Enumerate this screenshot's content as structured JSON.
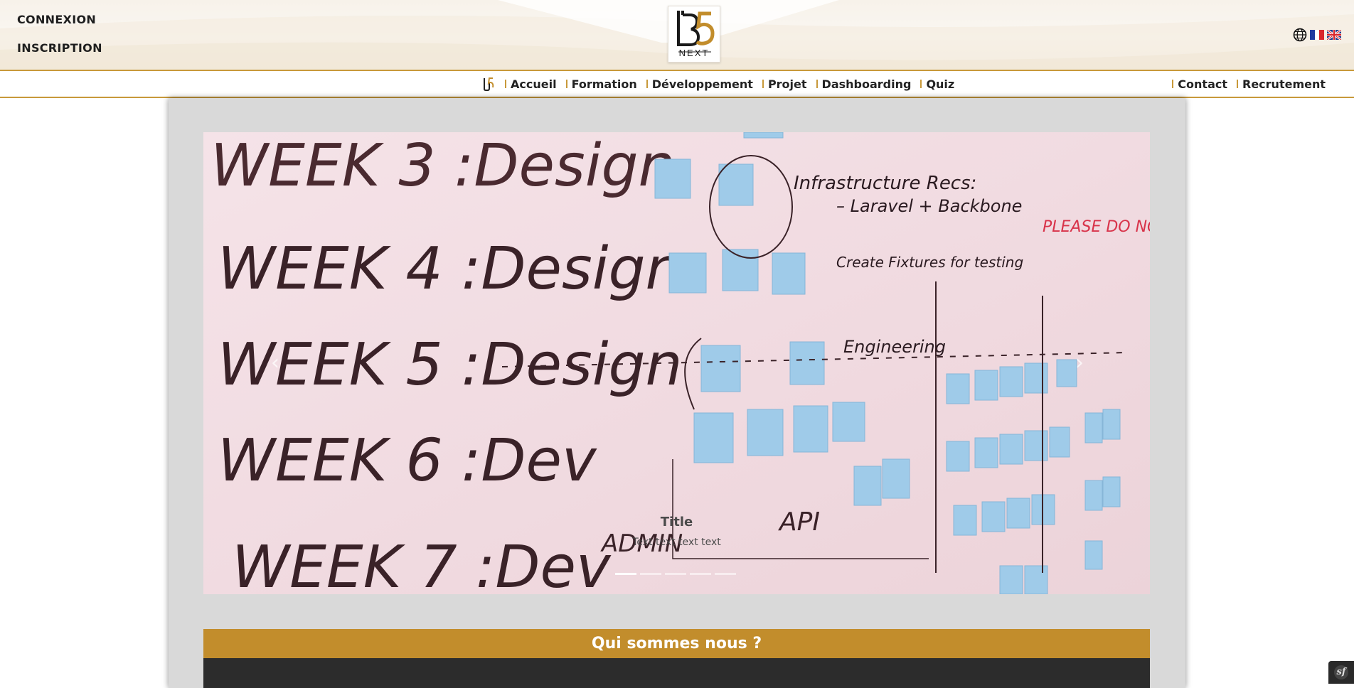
{
  "header": {
    "auth_links": [
      {
        "label": "CONNEXION"
      },
      {
        "label": "INSCRIPTION"
      }
    ],
    "logo": {
      "mark": "B5",
      "sub": "NEXT"
    },
    "languages": [
      {
        "icon": "globe-icon"
      },
      {
        "icon": "flag-fr-icon",
        "code": "fr"
      },
      {
        "icon": "flag-uk-icon",
        "code": "en"
      }
    ]
  },
  "nav": {
    "main_items": [
      {
        "label": "Accueil"
      },
      {
        "label": "Formation"
      },
      {
        "label": "Développement"
      },
      {
        "label": "Projet"
      },
      {
        "label": "Dashboarding"
      },
      {
        "label": "Quiz"
      }
    ],
    "right_items": [
      {
        "label": "Contact"
      },
      {
        "label": "Recrutement"
      }
    ]
  },
  "carousel": {
    "caption_title": "Title",
    "caption_text": "Text text text text",
    "slide_count": 5,
    "active_index": 0,
    "prev_glyph": "‹",
    "next_glyph": "›",
    "whiteboard_text": {
      "week3": "WEEK 3 :Design",
      "week4": "WEEK 4 :Design",
      "week5": "WEEK 5 :Design",
      "week6": "WEEK 6 :Dev",
      "week7": "WEEK 7 :Dev",
      "infra": "Infrastructure Recs:",
      "laravel": "– Laravel + Backbone",
      "fixtures": "Create Fixtures for testing",
      "engineering": "Engineering",
      "please": "PLEASE DO NOT ERA",
      "admin": "ADMIN",
      "api": "API"
    }
  },
  "section": {
    "title": "Qui sommes nous ?"
  },
  "colors": {
    "gold": "#c28d2c",
    "dark": "#2c2c2c",
    "panel": "#d9d9d9"
  }
}
